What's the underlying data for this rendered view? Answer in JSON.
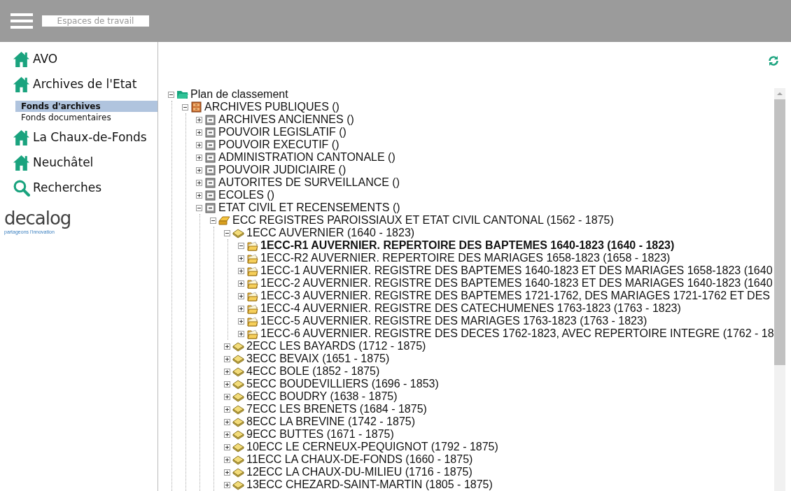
{
  "header": {
    "search": {
      "placeholder": "Espaces de travail"
    }
  },
  "sidebar": {
    "items": [
      {
        "label": "AVO",
        "kind": "home"
      },
      {
        "label": "Archives de l'Etat",
        "kind": "home",
        "children": [
          {
            "label": "Fonds d'archives",
            "selected": true
          },
          {
            "label": "Fonds documentaires",
            "selected": false
          }
        ]
      },
      {
        "label": "La Chaux-de-Fonds",
        "kind": "home"
      },
      {
        "label": "Neuchâtel",
        "kind": "home"
      },
      {
        "label": "Recherches",
        "kind": "search"
      }
    ],
    "logo": {
      "name": "decalog",
      "tagline": "partageons l'innovation"
    }
  },
  "tree": {
    "root": {
      "label": "Plan de classement",
      "kind": "root",
      "expanded": true,
      "selected": false,
      "children": [
        {
          "label": "ARCHIVES PUBLIQUES ()",
          "kind": "cabinet",
          "expanded": true,
          "selected": false,
          "children": [
            {
              "label": "ARCHIVES ANCIENNES ()",
              "kind": "drawer",
              "expanded": false,
              "selected": false
            },
            {
              "label": "POUVOIR LEGISLATIF ()",
              "kind": "drawer",
              "expanded": false,
              "selected": false
            },
            {
              "label": "POUVOIR EXECUTIF ()",
              "kind": "drawer",
              "expanded": false,
              "selected": false
            },
            {
              "label": "ADMINISTRATION CANTONALE ()",
              "kind": "drawer",
              "expanded": false,
              "selected": false
            },
            {
              "label": "POUVOIR JUDICIAIRE ()",
              "kind": "drawer",
              "expanded": false,
              "selected": false
            },
            {
              "label": "AUTORITES DE SURVEILLANCE ()",
              "kind": "drawer",
              "expanded": false,
              "selected": false
            },
            {
              "label": "ECOLES ()",
              "kind": "drawer",
              "expanded": false,
              "selected": false
            },
            {
              "label": "ETAT CIVIL ET RECENSEMENTS ()",
              "kind": "drawer",
              "expanded": true,
              "selected": false,
              "children": [
                {
                  "label": "ECC REGISTRES PAROISSIAUX ET ETAT CIVIL CANTONAL (1562 - 1875)",
                  "kind": "tray",
                  "expanded": true,
                  "selected": false,
                  "children": [
                    {
                      "label": "1ECC AUVERNIER (1640 - 1823)",
                      "kind": "book",
                      "expanded": true,
                      "selected": false,
                      "children": [
                        {
                          "label": "1ECC-R1 AUVERNIER. REPERTOIRE DES BAPTEMES 1640-1823 (1640 - 1823)",
                          "kind": "folder",
                          "expanded": true,
                          "selected": true
                        },
                        {
                          "label": "1ECC-R2 AUVERNIER. REPERTOIRE DES MARIAGES 1658-1823 (1658 - 1823)",
                          "kind": "folder",
                          "expanded": false,
                          "selected": false
                        },
                        {
                          "label": "1ECC-1 AUVERNIER. REGISTRE DES BAPTEMES 1640-1823 ET DES MARIAGES 1658-1823 (1640",
                          "kind": "folder",
                          "expanded": false,
                          "selected": false
                        },
                        {
                          "label": "1ECC-2 AUVERNIER. REGISTRE DES BAPTEMES 1640-1823 ET DES MARIAGES 1640-1823 (1640",
                          "kind": "folder",
                          "expanded": false,
                          "selected": false
                        },
                        {
                          "label": "1ECC-3 AUVERNIER. REGISTRE DES BAPTEMES 1721-1762, DES MARIAGES 1721-1762 ET DES",
                          "kind": "folder",
                          "expanded": false,
                          "selected": false
                        },
                        {
                          "label": "1ECC-4 AUVERNIER. REGISTRE DES CATECHUMENES 1763-1823 (1763 - 1823)",
                          "kind": "folder",
                          "expanded": false,
                          "selected": false
                        },
                        {
                          "label": "1ECC-5 AUVERNIER. REGISTRE DES MARIAGES 1763-1823 (1763 - 1823)",
                          "kind": "folder",
                          "expanded": false,
                          "selected": false
                        },
                        {
                          "label": "1ECC-6 AUVERNIER. REGISTRE DES DECES 1762-1823, AVEC REPERTOIRE INTEGRE (1762 - 18",
                          "kind": "folder",
                          "expanded": false,
                          "selected": false
                        }
                      ]
                    },
                    {
                      "label": "2ECC LES BAYARDS (1712 - 1875)",
                      "kind": "book",
                      "expanded": false,
                      "selected": false
                    },
                    {
                      "label": "3ECC BEVAIX (1651 - 1875)",
                      "kind": "book",
                      "expanded": false,
                      "selected": false
                    },
                    {
                      "label": "4ECC BOLE (1852 - 1875)",
                      "kind": "book",
                      "expanded": false,
                      "selected": false
                    },
                    {
                      "label": "5ECC BOUDEVILLIERS (1696 - 1853)",
                      "kind": "book",
                      "expanded": false,
                      "selected": false
                    },
                    {
                      "label": "6ECC BOUDRY (1638 - 1875)",
                      "kind": "book",
                      "expanded": false,
                      "selected": false
                    },
                    {
                      "label": "7ECC LES BRENETS (1684 - 1875)",
                      "kind": "book",
                      "expanded": false,
                      "selected": false
                    },
                    {
                      "label": "8ECC LA BREVINE (1742 - 1875)",
                      "kind": "book",
                      "expanded": false,
                      "selected": false
                    },
                    {
                      "label": "9ECC BUTTES (1671 - 1875)",
                      "kind": "book",
                      "expanded": false,
                      "selected": false
                    },
                    {
                      "label": "10ECC LE CERNEUX-PEQUIGNOT (1792 - 1875)",
                      "kind": "book",
                      "expanded": false,
                      "selected": false
                    },
                    {
                      "label": "11ECC LA CHAUX-DE-FONDS (1660 - 1875)",
                      "kind": "book",
                      "expanded": false,
                      "selected": false
                    },
                    {
                      "label": "12ECC LA CHAUX-DU-MILIEU (1716 - 1875)",
                      "kind": "book",
                      "expanded": false,
                      "selected": false
                    },
                    {
                      "label": "13ECC CHEZARD-SAINT-MARTIN (1805 - 1875)",
                      "kind": "book",
                      "expanded": false,
                      "selected": false
                    }
                  ]
                }
              ]
            }
          ]
        }
      ]
    }
  }
}
